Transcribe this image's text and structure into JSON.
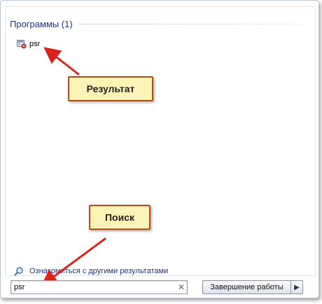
{
  "programs_group": {
    "title": "Программы (1)",
    "results": [
      {
        "label": "psr",
        "icon": "psr-app-icon"
      }
    ]
  },
  "annotations": {
    "result_label": "Результат",
    "search_label": "Поиск",
    "callout_fill": "#fcf3b7",
    "callout_border": "#b64a17",
    "arrow_color": "#d8231e"
  },
  "more_results": {
    "label": "Ознакомиться с другими результатами",
    "icon": "search-icon"
  },
  "search": {
    "value": "psr",
    "clear_icon": "close-icon"
  },
  "shutdown": {
    "label": "Завершение работы",
    "arrow_icon": "triangle-right-icon"
  }
}
